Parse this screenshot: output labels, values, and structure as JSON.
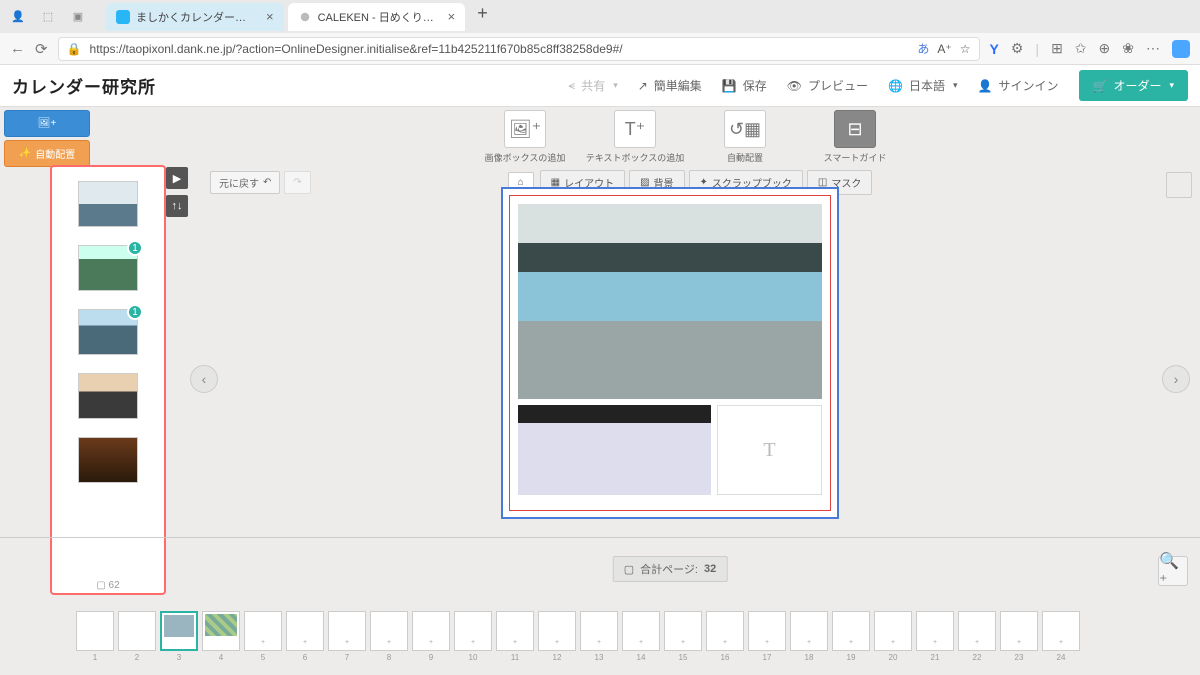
{
  "browser": {
    "tabs": [
      {
        "title": "ましかくカレンダー（日めくり）-",
        "active": false
      },
      {
        "title": "CALEKEN - 日めくりカレンダー#",
        "active": true
      }
    ],
    "url": "https://taopixonl.dank.ne.jp/?action=OnlineDesigner.initialise&ref=11b425211f670b85c8ff38258de9#/"
  },
  "logo": "カレンダー研究所",
  "header": {
    "share": "共有",
    "simple_edit": "簡単編集",
    "save": "保存",
    "preview": "プレビュー",
    "language": "日本語",
    "signin": "サインイン",
    "order": "オーダー"
  },
  "left": {
    "add_image": "",
    "auto_arrange": "自動配置",
    "count": "62",
    "badges": [
      "1",
      "1"
    ]
  },
  "tools": {
    "big": [
      {
        "label": "画像ボックスの追加",
        "icon": "img"
      },
      {
        "label": "テキストボックスの追加",
        "icon": "T+"
      },
      {
        "label": "自動配置",
        "icon": "auto"
      },
      {
        "label": "スマートガイド",
        "icon": "guide",
        "active": true
      }
    ],
    "undo": "元に戻す",
    "redo": "",
    "tabs": [
      "レイアウト",
      "背景",
      "スクラップブック",
      "マスク"
    ]
  },
  "canvas": {
    "text_placeholder": "T",
    "counter_label": "合計ページ:",
    "counter_value": "32"
  },
  "filmstrip": {
    "count": 24,
    "selected": 3
  }
}
